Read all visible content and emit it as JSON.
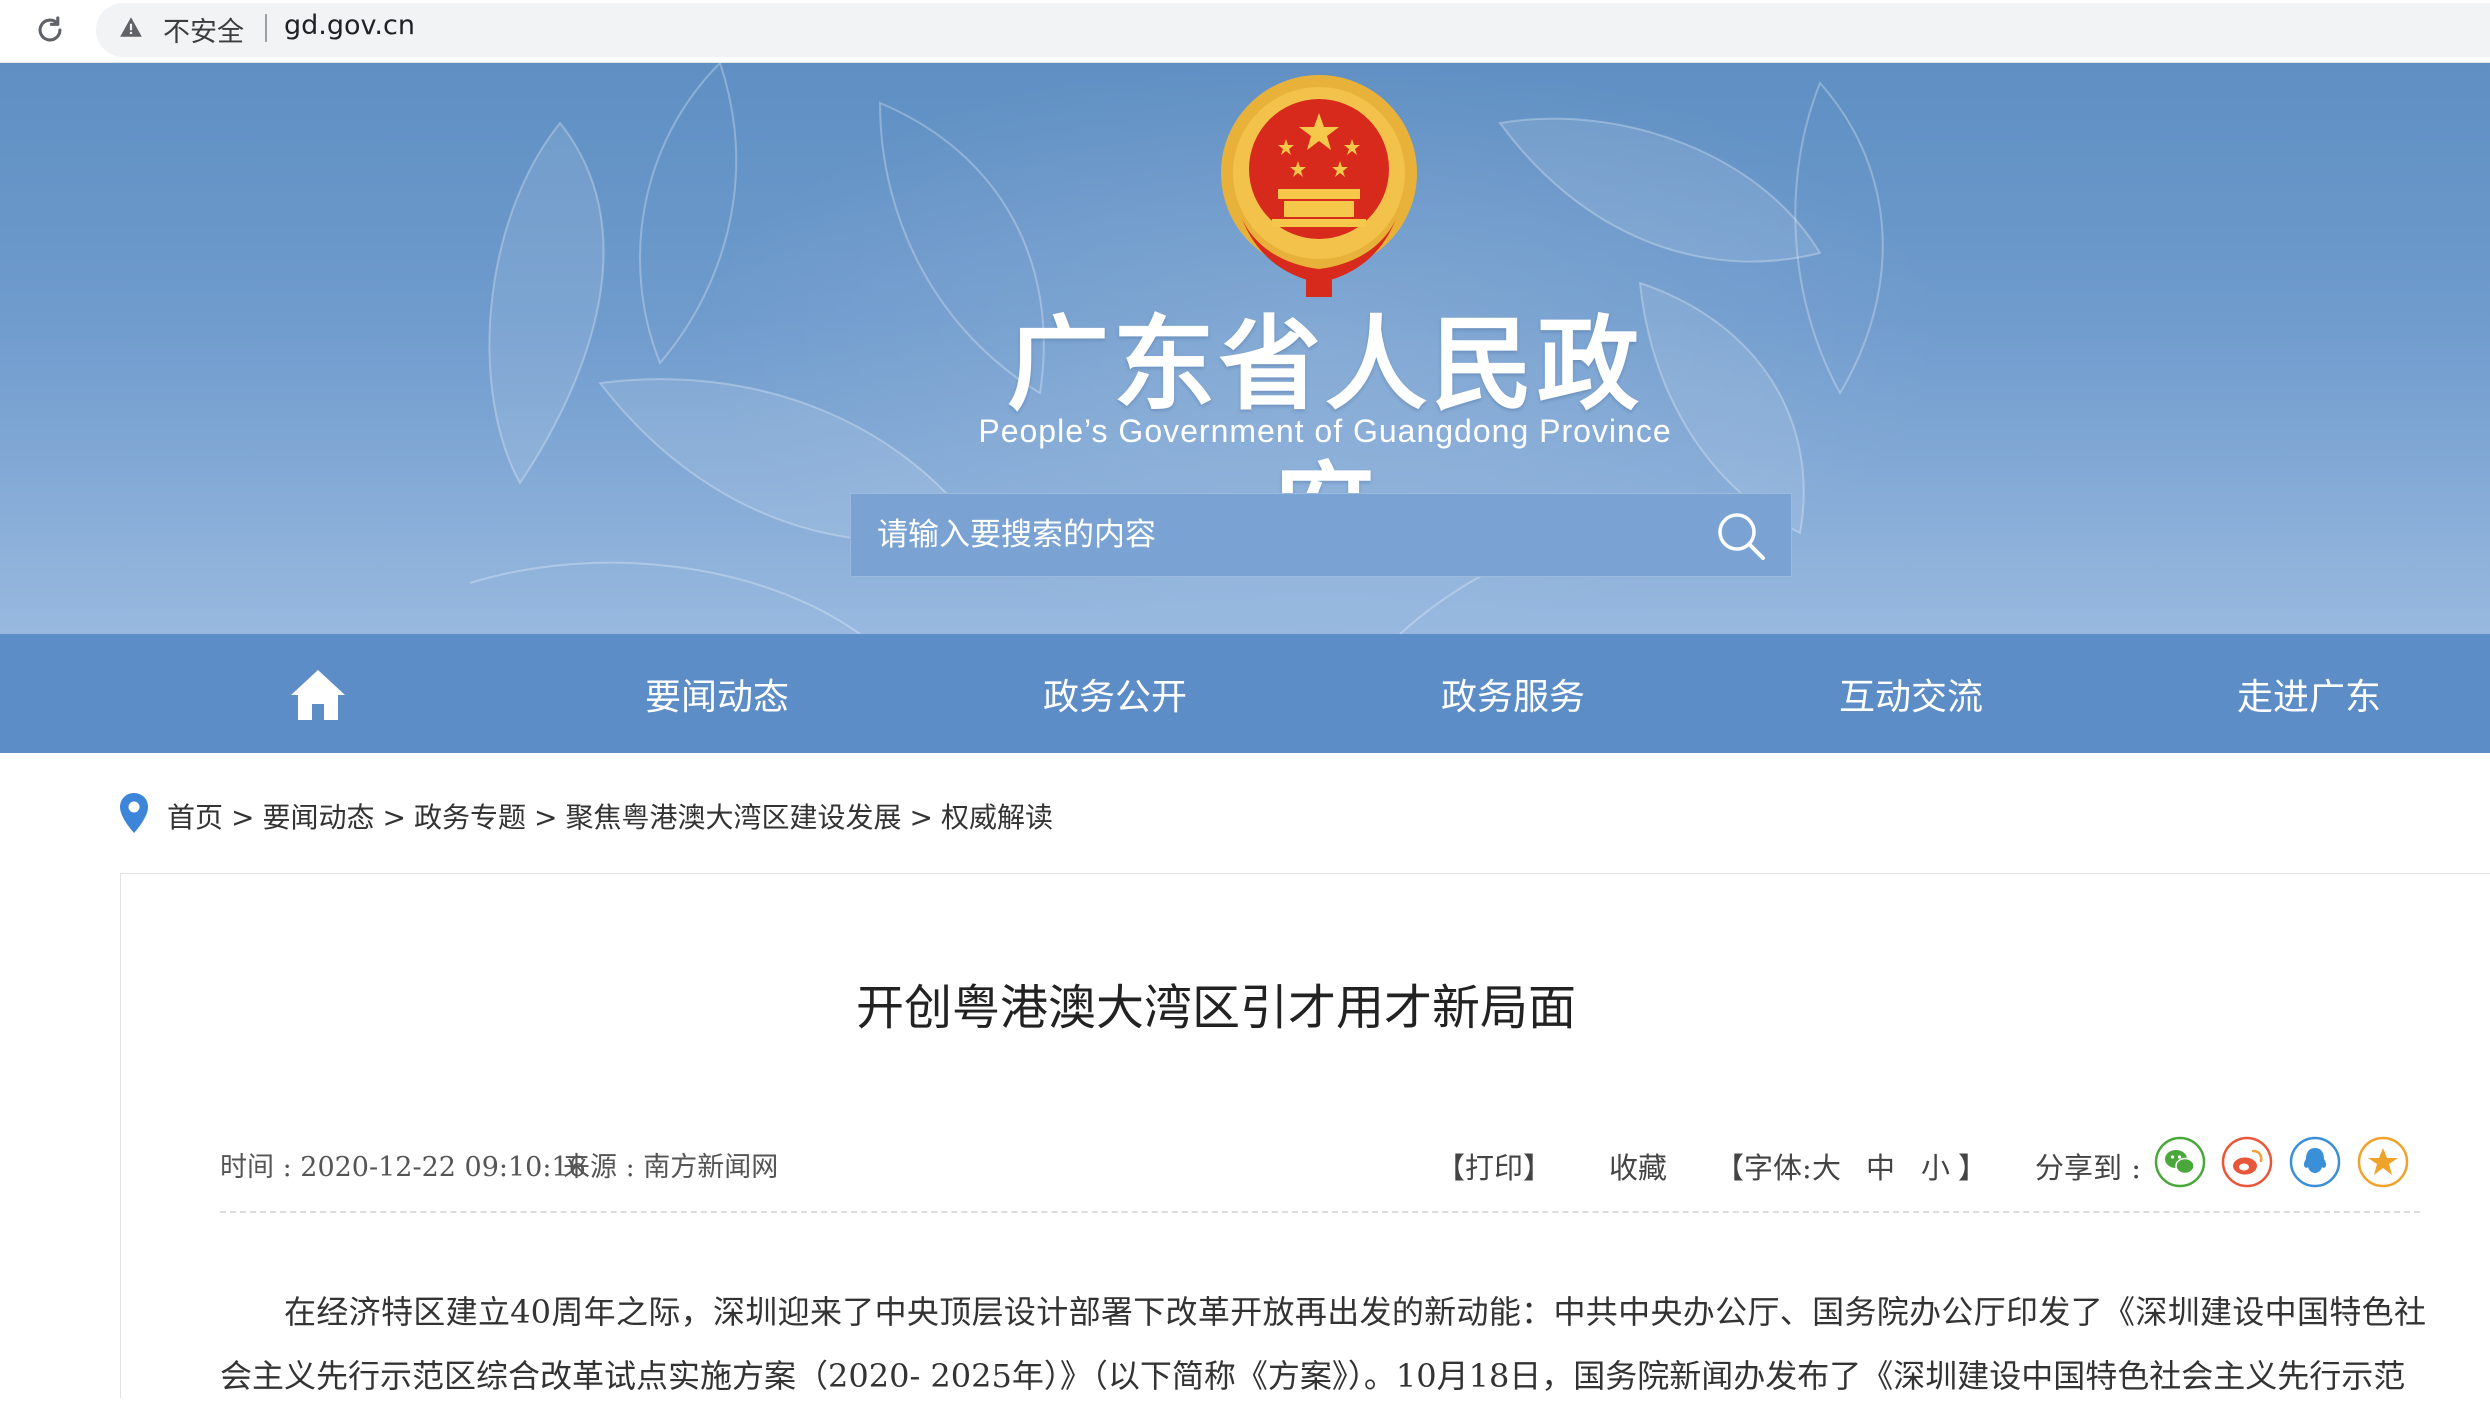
{
  "browser": {
    "security_label": "不安全",
    "url": "gd.gov.cn"
  },
  "header": {
    "site_title": "广东省人民政府",
    "site_subtitle": "People’s Government of Guangdong Province",
    "search_placeholder": "请输入要搜索的内容"
  },
  "nav": {
    "items": [
      "要闻动态",
      "政务公开",
      "政务服务",
      "互动交流",
      "走进广东"
    ]
  },
  "breadcrumb": [
    "首页",
    "要闻动态",
    "政务专题",
    "聚焦粤港澳大湾区建设发展",
    "权威解读"
  ],
  "article": {
    "title": "开创粤港澳大湾区引才用才新局面",
    "time": "时间 : 2020-12-22 09:10:16",
    "source": "来源 : 南方新闻网",
    "print": "【打印】",
    "favorite": "收藏",
    "font_label": "【字体:",
    "font_large": "大",
    "font_medium": "中",
    "font_small": "小",
    "font_close": "】",
    "share_label": "分享到 :",
    "paragraph": "在经济特区建立40周年之际，深圳迎来了中央顶层设计部署下改革开放再出发的新动能：中共中央办公厅、国务院办公厅印发了《深圳建设中国特色社会主义先行示范区综合改革试点实施方案（2020- 2025年）》（以下简称《方案》）。10月18日，国务院新闻办发布了《深圳建设中国特色社会主义先行示范"
  },
  "colors": {
    "nav_bg": "#5d8dc6",
    "wechat": "#4aa73c",
    "weibo": "#e8573a",
    "qq": "#3b8fd9",
    "favorite_star": "#f0a32a"
  },
  "icons": [
    "reload-icon",
    "warning-icon",
    "national-emblem",
    "search-icon",
    "home-icon",
    "location-pin-icon",
    "wechat-icon",
    "weibo-icon",
    "qq-icon",
    "star-icon"
  ]
}
